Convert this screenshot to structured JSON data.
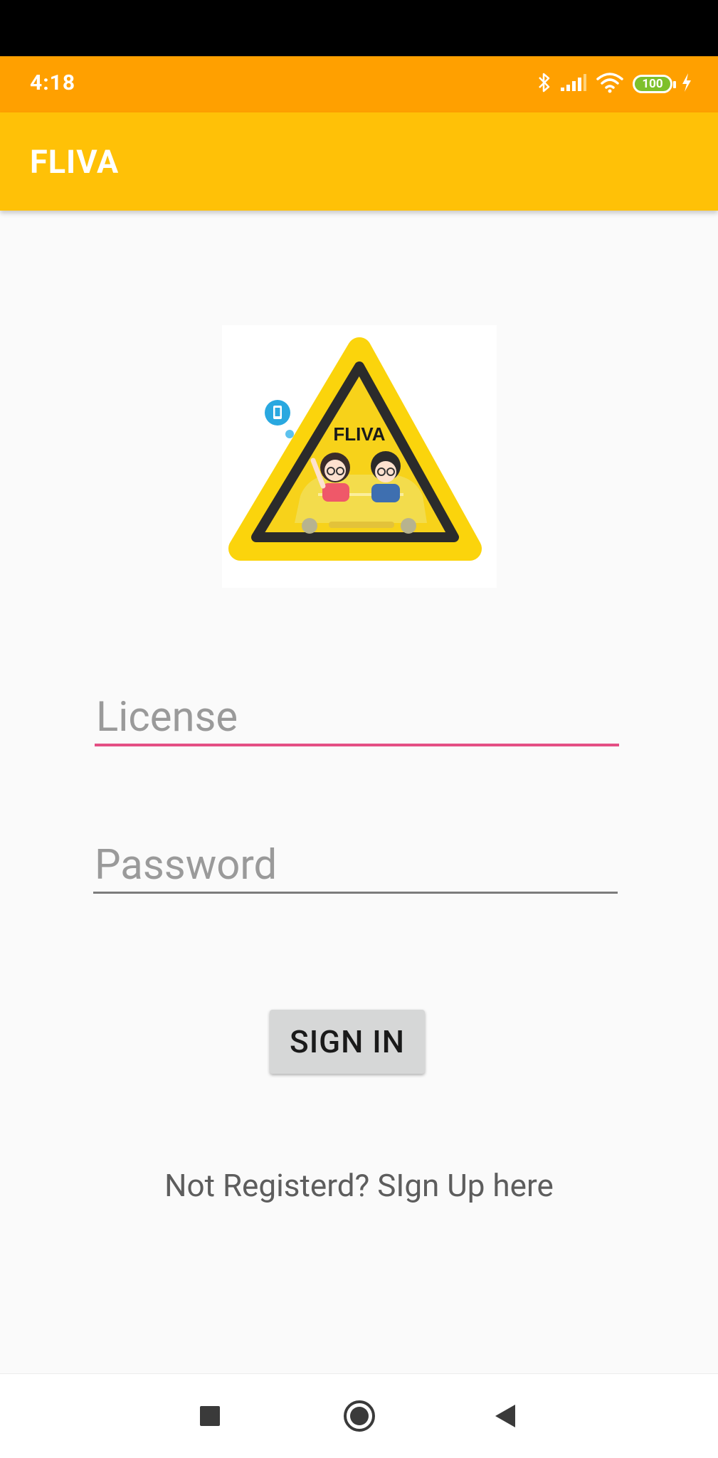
{
  "status_bar": {
    "time": "4:18",
    "battery_level": "100",
    "icons": [
      "bluetooth-icon",
      "signal-icon",
      "wifi-icon",
      "battery-icon",
      "charging-icon"
    ]
  },
  "app_bar": {
    "title": "FLIVA"
  },
  "logo": {
    "text": "FLIVA"
  },
  "form": {
    "license_placeholder": "License",
    "license_value": "",
    "password_placeholder": "Password",
    "password_value": ""
  },
  "actions": {
    "sign_in_label": "SIGN IN",
    "signup_link": "Not Registerd? SIgn Up here"
  },
  "nav_bar": {
    "items": [
      "recent-apps-icon",
      "home-icon",
      "back-icon"
    ]
  },
  "colors": {
    "status_bar": "#ffa000",
    "app_bar": "#ffc107",
    "accent_underline": "#e44f84",
    "background": "#fafafa",
    "button": "#d6d7d7"
  }
}
